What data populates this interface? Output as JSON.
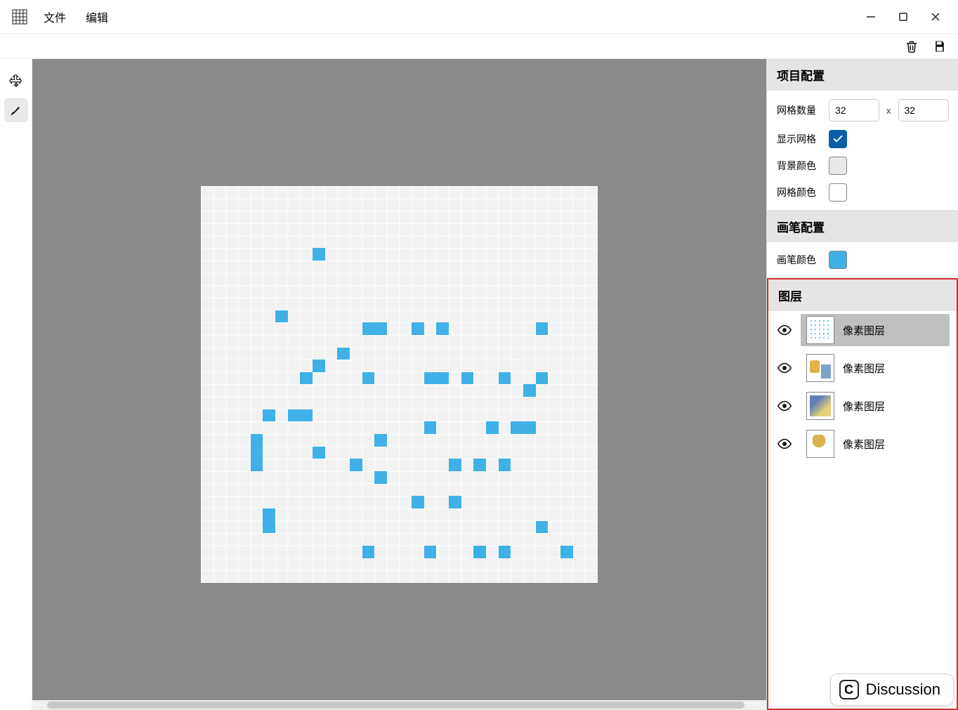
{
  "menu": {
    "file": "文件",
    "edit": "编辑"
  },
  "sidebar": {
    "project": {
      "title": "项目配置",
      "gridCountLabel": "网格数量",
      "gridW": "32",
      "gridH": "32",
      "sepX": "x",
      "showGridLabel": "显示网格",
      "showGrid": true,
      "bgColorLabel": "背景颜色",
      "bgColor": "#e9e9e9",
      "gridColorLabel": "网格颜色",
      "gridColor": "#ffffff"
    },
    "brush": {
      "title": "画笔配置",
      "brushColorLabel": "画笔颜色",
      "brushColor": "#3fb1e6"
    },
    "layers": {
      "title": "图层",
      "items": [
        {
          "name": "像素图层",
          "visible": true,
          "active": true,
          "thumbClass": "dots"
        },
        {
          "name": "像素图层",
          "visible": true,
          "active": false,
          "thumbClass": "c1"
        },
        {
          "name": "像素图层",
          "visible": true,
          "active": false,
          "thumbClass": "c2"
        },
        {
          "name": "像素图层",
          "visible": true,
          "active": false,
          "thumbClass": "c3"
        }
      ]
    }
  },
  "discussion": {
    "label": "Discussion",
    "badge": "C"
  },
  "canvas": {
    "grid": 32,
    "cellSize": 17.65,
    "paintedColor": "#3fb1e6",
    "paintedCells": [
      [
        9,
        5
      ],
      [
        6,
        10
      ],
      [
        13,
        11
      ],
      [
        14,
        11
      ],
      [
        17,
        11
      ],
      [
        19,
        11
      ],
      [
        27,
        11
      ],
      [
        11,
        13
      ],
      [
        9,
        14
      ],
      [
        8,
        15
      ],
      [
        13,
        15
      ],
      [
        18,
        15
      ],
      [
        19,
        15
      ],
      [
        21,
        15
      ],
      [
        24,
        15
      ],
      [
        27,
        15
      ],
      [
        26,
        16
      ],
      [
        5,
        18
      ],
      [
        7,
        18
      ],
      [
        8,
        18
      ],
      [
        18,
        19
      ],
      [
        23,
        19
      ],
      [
        25,
        19
      ],
      [
        26,
        19
      ],
      [
        4,
        20
      ],
      [
        14,
        20
      ],
      [
        4,
        21
      ],
      [
        9,
        21
      ],
      [
        4,
        22
      ],
      [
        12,
        22
      ],
      [
        20,
        22
      ],
      [
        22,
        22
      ],
      [
        24,
        22
      ],
      [
        14,
        23
      ],
      [
        17,
        25
      ],
      [
        20,
        25
      ],
      [
        5,
        26
      ],
      [
        5,
        27
      ],
      [
        27,
        27
      ],
      [
        13,
        29
      ],
      [
        18,
        29
      ],
      [
        22,
        29
      ],
      [
        24,
        29
      ],
      [
        29,
        29
      ]
    ]
  }
}
